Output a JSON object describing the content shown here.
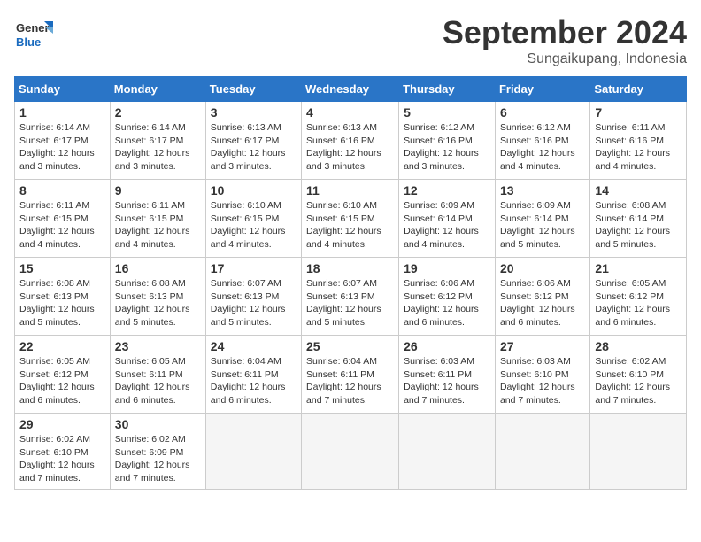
{
  "header": {
    "logo_general": "General",
    "logo_blue": "Blue",
    "month": "September 2024",
    "location": "Sungaikupang, Indonesia"
  },
  "days_of_week": [
    "Sunday",
    "Monday",
    "Tuesday",
    "Wednesday",
    "Thursday",
    "Friday",
    "Saturday"
  ],
  "weeks": [
    [
      {
        "day": "1",
        "sunrise": "6:14 AM",
        "sunset": "6:17 PM",
        "daylight": "12 hours and 3 minutes."
      },
      {
        "day": "2",
        "sunrise": "6:14 AM",
        "sunset": "6:17 PM",
        "daylight": "12 hours and 3 minutes."
      },
      {
        "day": "3",
        "sunrise": "6:13 AM",
        "sunset": "6:17 PM",
        "daylight": "12 hours and 3 minutes."
      },
      {
        "day": "4",
        "sunrise": "6:13 AM",
        "sunset": "6:16 PM",
        "daylight": "12 hours and 3 minutes."
      },
      {
        "day": "5",
        "sunrise": "6:12 AM",
        "sunset": "6:16 PM",
        "daylight": "12 hours and 3 minutes."
      },
      {
        "day": "6",
        "sunrise": "6:12 AM",
        "sunset": "6:16 PM",
        "daylight": "12 hours and 4 minutes."
      },
      {
        "day": "7",
        "sunrise": "6:11 AM",
        "sunset": "6:16 PM",
        "daylight": "12 hours and 4 minutes."
      }
    ],
    [
      {
        "day": "8",
        "sunrise": "6:11 AM",
        "sunset": "6:15 PM",
        "daylight": "12 hours and 4 minutes."
      },
      {
        "day": "9",
        "sunrise": "6:11 AM",
        "sunset": "6:15 PM",
        "daylight": "12 hours and 4 minutes."
      },
      {
        "day": "10",
        "sunrise": "6:10 AM",
        "sunset": "6:15 PM",
        "daylight": "12 hours and 4 minutes."
      },
      {
        "day": "11",
        "sunrise": "6:10 AM",
        "sunset": "6:15 PM",
        "daylight": "12 hours and 4 minutes."
      },
      {
        "day": "12",
        "sunrise": "6:09 AM",
        "sunset": "6:14 PM",
        "daylight": "12 hours and 4 minutes."
      },
      {
        "day": "13",
        "sunrise": "6:09 AM",
        "sunset": "6:14 PM",
        "daylight": "12 hours and 5 minutes."
      },
      {
        "day": "14",
        "sunrise": "6:08 AM",
        "sunset": "6:14 PM",
        "daylight": "12 hours and 5 minutes."
      }
    ],
    [
      {
        "day": "15",
        "sunrise": "6:08 AM",
        "sunset": "6:13 PM",
        "daylight": "12 hours and 5 minutes."
      },
      {
        "day": "16",
        "sunrise": "6:08 AM",
        "sunset": "6:13 PM",
        "daylight": "12 hours and 5 minutes."
      },
      {
        "day": "17",
        "sunrise": "6:07 AM",
        "sunset": "6:13 PM",
        "daylight": "12 hours and 5 minutes."
      },
      {
        "day": "18",
        "sunrise": "6:07 AM",
        "sunset": "6:13 PM",
        "daylight": "12 hours and 5 minutes."
      },
      {
        "day": "19",
        "sunrise": "6:06 AM",
        "sunset": "6:12 PM",
        "daylight": "12 hours and 6 minutes."
      },
      {
        "day": "20",
        "sunrise": "6:06 AM",
        "sunset": "6:12 PM",
        "daylight": "12 hours and 6 minutes."
      },
      {
        "day": "21",
        "sunrise": "6:05 AM",
        "sunset": "6:12 PM",
        "daylight": "12 hours and 6 minutes."
      }
    ],
    [
      {
        "day": "22",
        "sunrise": "6:05 AM",
        "sunset": "6:12 PM",
        "daylight": "12 hours and 6 minutes."
      },
      {
        "day": "23",
        "sunrise": "6:05 AM",
        "sunset": "6:11 PM",
        "daylight": "12 hours and 6 minutes."
      },
      {
        "day": "24",
        "sunrise": "6:04 AM",
        "sunset": "6:11 PM",
        "daylight": "12 hours and 6 minutes."
      },
      {
        "day": "25",
        "sunrise": "6:04 AM",
        "sunset": "6:11 PM",
        "daylight": "12 hours and 7 minutes."
      },
      {
        "day": "26",
        "sunrise": "6:03 AM",
        "sunset": "6:11 PM",
        "daylight": "12 hours and 7 minutes."
      },
      {
        "day": "27",
        "sunrise": "6:03 AM",
        "sunset": "6:10 PM",
        "daylight": "12 hours and 7 minutes."
      },
      {
        "day": "28",
        "sunrise": "6:02 AM",
        "sunset": "6:10 PM",
        "daylight": "12 hours and 7 minutes."
      }
    ],
    [
      {
        "day": "29",
        "sunrise": "6:02 AM",
        "sunset": "6:10 PM",
        "daylight": "12 hours and 7 minutes."
      },
      {
        "day": "30",
        "sunrise": "6:02 AM",
        "sunset": "6:09 PM",
        "daylight": "12 hours and 7 minutes."
      },
      null,
      null,
      null,
      null,
      null
    ]
  ]
}
